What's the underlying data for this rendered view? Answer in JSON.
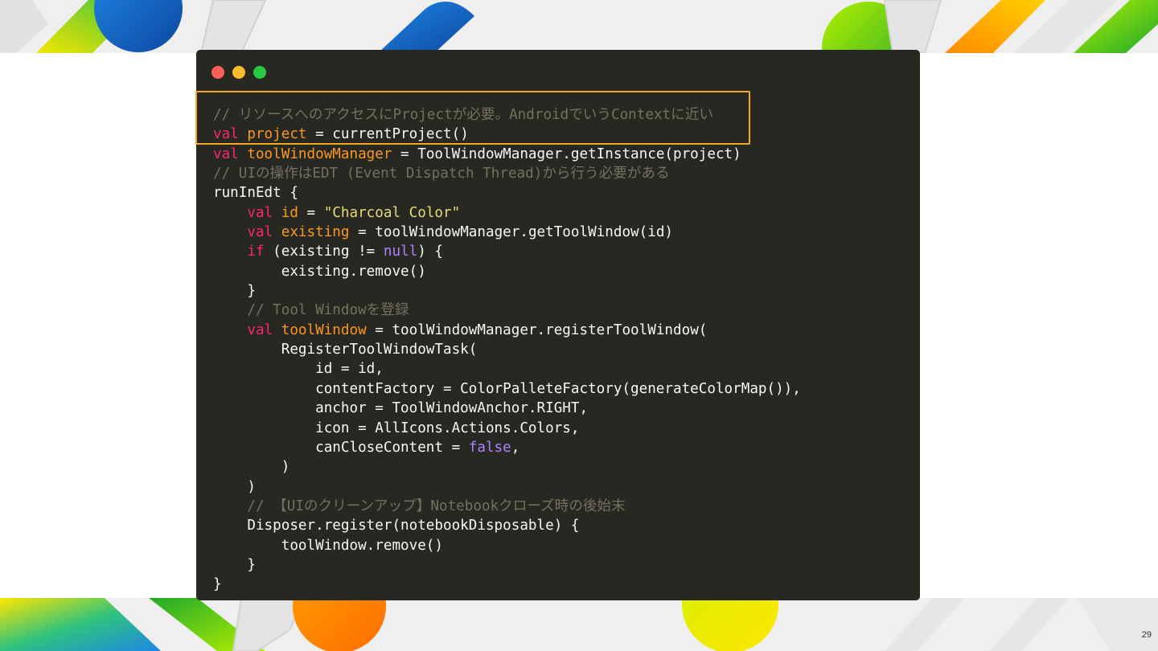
{
  "slide": {
    "page_number": "29"
  },
  "colors": {
    "code_background": "#272822",
    "keyword": "#f92672",
    "variable": "#fd971f",
    "string": "#e6db74",
    "literal": "#ae81ff",
    "comment": "#75715e",
    "plain": "#f8f8f2",
    "highlight_border": "#f5a623",
    "window_dot_red": "#ff5f56",
    "window_dot_yellow": "#ffbd2e",
    "window_dot_green": "#27c93f"
  },
  "code": {
    "language": "kotlin",
    "highlighted_lines": [
      1,
      2
    ],
    "lines": [
      [
        {
          "t": "cmt",
          "v": "// リソースへのアクセスにProjectが必要。AndroidでいうContextに近い"
        }
      ],
      [
        {
          "t": "kw",
          "v": "val"
        },
        {
          "t": "plain",
          "v": " "
        },
        {
          "t": "var",
          "v": "project"
        },
        {
          "t": "plain",
          "v": " = currentProject()"
        }
      ],
      [
        {
          "t": "kw",
          "v": "val"
        },
        {
          "t": "plain",
          "v": " "
        },
        {
          "t": "var",
          "v": "toolWindowManager"
        },
        {
          "t": "plain",
          "v": " = ToolWindowManager.getInstance(project)"
        }
      ],
      [
        {
          "t": "cmt",
          "v": "// UIの操作はEDT (Event Dispatch Thread)から行う必要がある"
        }
      ],
      [
        {
          "t": "plain",
          "v": "runInEdt {"
        }
      ],
      [
        {
          "t": "plain",
          "v": "    "
        },
        {
          "t": "kw",
          "v": "val"
        },
        {
          "t": "plain",
          "v": " "
        },
        {
          "t": "var",
          "v": "id"
        },
        {
          "t": "plain",
          "v": " = "
        },
        {
          "t": "str",
          "v": "\"Charcoal Color\""
        }
      ],
      [
        {
          "t": "plain",
          "v": "    "
        },
        {
          "t": "kw",
          "v": "val"
        },
        {
          "t": "plain",
          "v": " "
        },
        {
          "t": "var",
          "v": "existing"
        },
        {
          "t": "plain",
          "v": " = toolWindowManager.getToolWindow(id)"
        }
      ],
      [
        {
          "t": "plain",
          "v": "    "
        },
        {
          "t": "kw",
          "v": "if"
        },
        {
          "t": "plain",
          "v": " (existing != "
        },
        {
          "t": "lit",
          "v": "null"
        },
        {
          "t": "plain",
          "v": ") {"
        }
      ],
      [
        {
          "t": "plain",
          "v": "        existing.remove()"
        }
      ],
      [
        {
          "t": "plain",
          "v": "    }"
        }
      ],
      [
        {
          "t": "plain",
          "v": "    "
        },
        {
          "t": "cmt",
          "v": "// Tool Windowを登録"
        }
      ],
      [
        {
          "t": "plain",
          "v": "    "
        },
        {
          "t": "kw",
          "v": "val"
        },
        {
          "t": "plain",
          "v": " "
        },
        {
          "t": "var",
          "v": "toolWindow"
        },
        {
          "t": "plain",
          "v": " = toolWindowManager.registerToolWindow("
        }
      ],
      [
        {
          "t": "plain",
          "v": "        RegisterToolWindowTask("
        }
      ],
      [
        {
          "t": "plain",
          "v": "            id = id,"
        }
      ],
      [
        {
          "t": "plain",
          "v": "            contentFactory = ColorPalleteFactory(generateColorMap()),"
        }
      ],
      [
        {
          "t": "plain",
          "v": "            anchor = ToolWindowAnchor.RIGHT,"
        }
      ],
      [
        {
          "t": "plain",
          "v": "            icon = AllIcons.Actions.Colors,"
        }
      ],
      [
        {
          "t": "plain",
          "v": "            canCloseContent = "
        },
        {
          "t": "lit",
          "v": "false"
        },
        {
          "t": "plain",
          "v": ","
        }
      ],
      [
        {
          "t": "plain",
          "v": "        )"
        }
      ],
      [
        {
          "t": "plain",
          "v": "    )"
        }
      ],
      [
        {
          "t": "plain",
          "v": "    "
        },
        {
          "t": "cmt",
          "v": "// 【UIのクリーンアップ】Notebookクローズ時の後始末"
        }
      ],
      [
        {
          "t": "plain",
          "v": "    Disposer.register(notebookDisposable) {"
        }
      ],
      [
        {
          "t": "plain",
          "v": "        toolWindow.remove()"
        }
      ],
      [
        {
          "t": "plain",
          "v": "    }"
        }
      ],
      [
        {
          "t": "plain",
          "v": "}"
        }
      ]
    ]
  }
}
